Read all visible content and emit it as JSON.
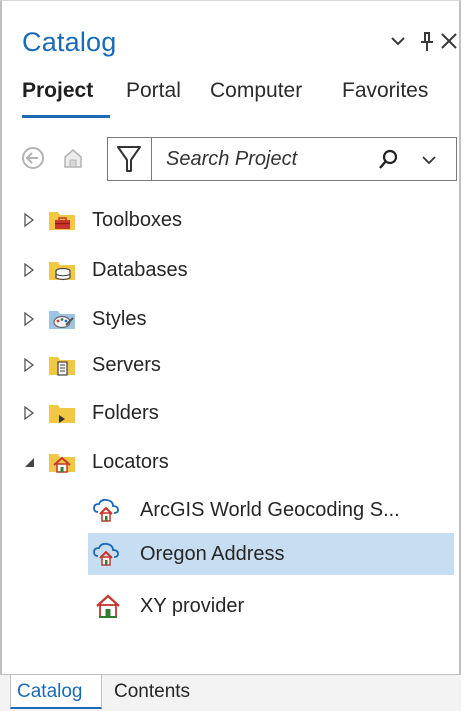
{
  "pane": {
    "title": "Catalog",
    "controls": {
      "options": "⌄",
      "pin": "pin",
      "close": "✕"
    }
  },
  "tabs": [
    {
      "label": "Project",
      "active": true
    },
    {
      "label": "Portal",
      "active": false
    },
    {
      "label": "Computer",
      "active": false
    },
    {
      "label": "Favorites",
      "active": false
    }
  ],
  "toolbar": {
    "search": {
      "placeholder": "Search Project",
      "value": ""
    }
  },
  "tree": {
    "items": [
      {
        "label": "Toolboxes",
        "icon": "toolbox-folder-icon",
        "expanded": false
      },
      {
        "label": "Databases",
        "icon": "database-folder-icon",
        "expanded": false
      },
      {
        "label": "Styles",
        "icon": "styles-folder-icon",
        "expanded": false
      },
      {
        "label": "Servers",
        "icon": "servers-folder-icon",
        "expanded": false
      },
      {
        "label": "Folders",
        "icon": "folders-folder-icon",
        "expanded": false
      },
      {
        "label": "Locators",
        "icon": "locators-folder-icon",
        "expanded": true
      },
      {
        "label": "ArcGIS World Geocoding S...",
        "icon": "cloud-locator-icon"
      },
      {
        "label": "Oregon Address",
        "icon": "cloud-locator-icon",
        "selected": true
      },
      {
        "label": "XY provider",
        "icon": "house-locator-icon"
      }
    ]
  },
  "bottom_tabs": [
    {
      "label": "Catalog",
      "active": true
    },
    {
      "label": "Contents",
      "active": false
    }
  ],
  "colors": {
    "accent": "#1a6ab8",
    "selection": "#c7def2",
    "folder": "#f2c744"
  }
}
